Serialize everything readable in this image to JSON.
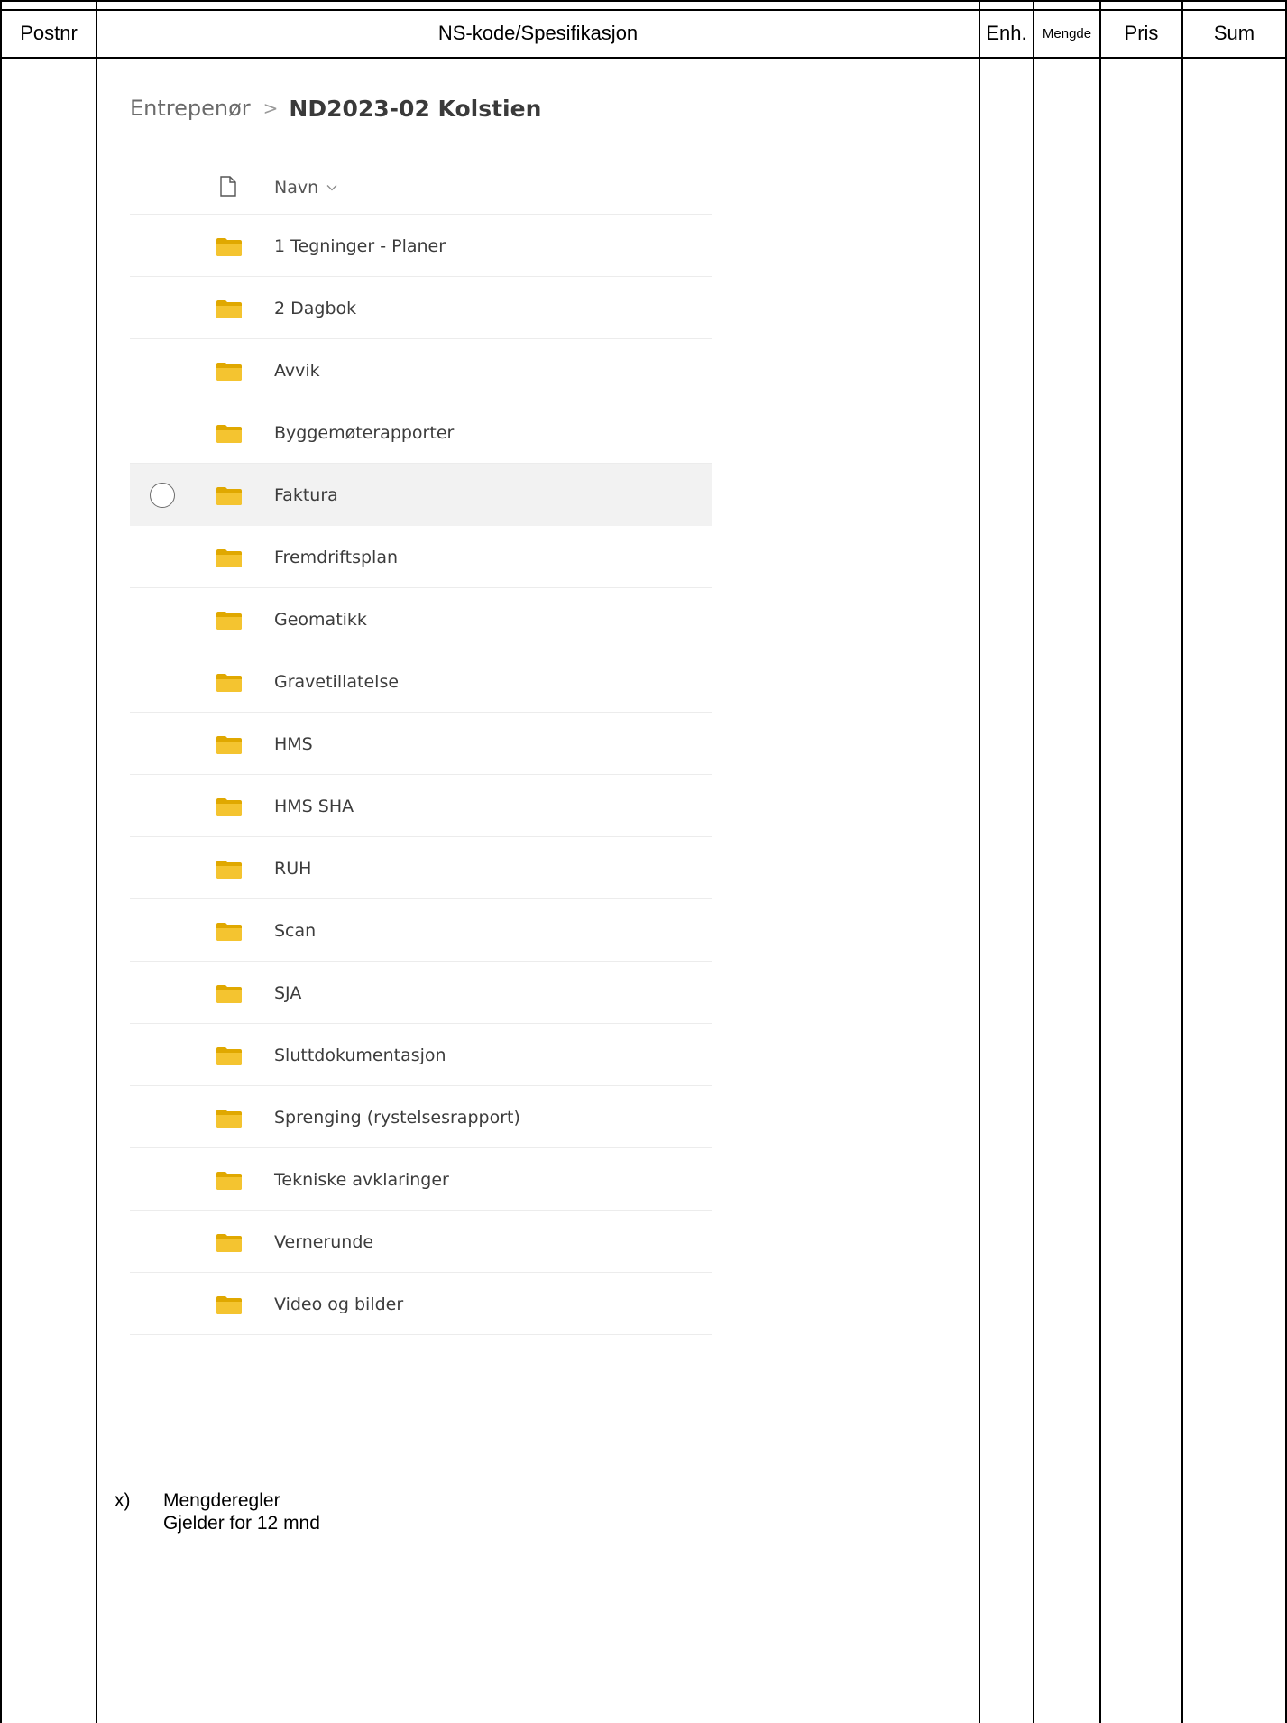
{
  "table": {
    "headers": {
      "postnr": "Postnr",
      "spec": "NS-kode/Spesifikasjon",
      "enhet": "Enh.",
      "mengde": "Mengde",
      "pris": "Pris",
      "sum": "Sum"
    }
  },
  "screenshot": {
    "breadcrumb": {
      "parent": "Entrepenør",
      "separator": ">",
      "current": "ND2023-02 Kolstien"
    },
    "list_header": {
      "name_label": "Navn"
    },
    "folders": [
      "1 Tegninger - Planer",
      "2 Dagbok",
      "Avvik",
      "Byggemøterapporter",
      "Faktura",
      "Fremdriftsplan",
      "Geomatikk",
      "Gravetillatelse",
      "HMS",
      "HMS SHA",
      "RUH",
      "Scan",
      "SJA",
      "Sluttdokumentasjon",
      "Sprenging (rystelsesrapport)",
      "Tekniske avklaringer",
      "Vernerunde",
      "Video og bilder"
    ],
    "hovered_folder": "Faktura",
    "folder_color": "#f4c430",
    "icons": {
      "file": "file-icon",
      "sort": "chevron-down-icon",
      "folder": "folder-icon",
      "select": "radio-circle-icon"
    }
  },
  "notes": {
    "marker": "x)",
    "title": "Mengderegler",
    "text": "Gjelder for 12 mnd"
  }
}
